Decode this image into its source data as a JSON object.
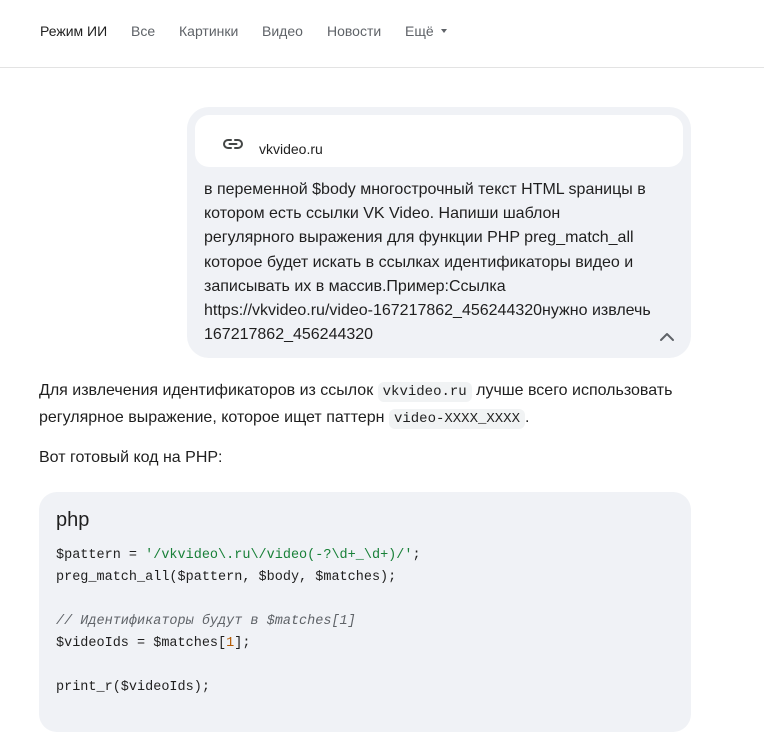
{
  "nav": {
    "items": [
      "Режим ИИ",
      "Все",
      "Картинки",
      "Видео",
      "Новости",
      "Ещё"
    ]
  },
  "user_message": {
    "link_label": "vkvideo.ru",
    "text": "в переменной $body многострочный текст HTML sраницы в\nкотором есть ссылки VK Video. Напиши шаблон\nрегулярного выражения для функции PHP preg_match_all\nкоторое будет искать в ссылках идентификаторы видео и\nзаписывать их в массив.Пример:Ссылка\nhttps://vkvideo.ru/video-167217862_456244320нужно извлечь\n167217862_456244320"
  },
  "answer": {
    "p1_a": "Для извлечения идентификаторов из ссылок ",
    "p1_code1": "vkvideo.ru",
    "p1_b": " лучше всего использовать регулярное выражение, которое ищет паттерн ",
    "p1_code2": "video-XXXX_XXXX",
    "p1_c": ".",
    "p2": "Вот готовый код на PHP:"
  },
  "code": {
    "language": "php",
    "l1_a": "$pattern = ",
    "l1_str": "'/vkvideo\\.ru\\/video(-?\\d+_\\d+)/'",
    "l1_b": ";",
    "l2": "preg_match_all($pattern, $body, $matches);",
    "l3_comment": "// Идентификаторы будут в $matches[1]",
    "l4_a": "$videoIds = $matches[",
    "l4_num": "1",
    "l4_b": "];",
    "l5": "print_r($videoIds);"
  },
  "colors": {
    "string": "#188038",
    "comment": "#5f6368",
    "number": "#b35900",
    "bubble_bg": "#f0f2f6"
  }
}
